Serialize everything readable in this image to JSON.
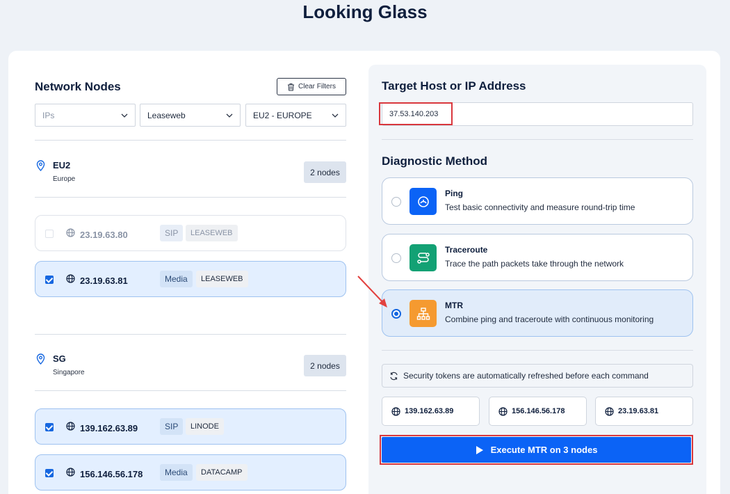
{
  "page": {
    "title": "Looking Glass"
  },
  "nodes_panel": {
    "title": "Network Nodes",
    "clear_filters_label": "Clear Filters",
    "filters": {
      "ips_placeholder": "IPs",
      "provider": "Leaseweb",
      "region": "EU2 - EUROPE"
    },
    "regions": [
      {
        "code": "EU2",
        "name": "Europe",
        "count_label": "2 nodes",
        "nodes": [
          {
            "ip": "23.19.63.80",
            "type": "SIP",
            "provider": "LEASEWEB",
            "checked": false,
            "disabled": true
          },
          {
            "ip": "23.19.63.81",
            "type": "Media",
            "provider": "LEASEWEB",
            "checked": true,
            "disabled": false
          }
        ]
      },
      {
        "code": "SG",
        "name": "Singapore",
        "count_label": "2 nodes",
        "nodes": [
          {
            "ip": "139.162.63.89",
            "type": "SIP",
            "provider": "LINODE",
            "checked": true,
            "disabled": false
          },
          {
            "ip": "156.146.56.178",
            "type": "Media",
            "provider": "DATACAMP",
            "checked": true,
            "disabled": false
          }
        ]
      }
    ]
  },
  "target": {
    "label": "Target Host or IP Address",
    "value": "37.53.140.203"
  },
  "method": {
    "label": "Diagnostic Method",
    "options": [
      {
        "title": "Ping",
        "description": "Test basic connectivity and measure round-trip time",
        "icon": "ping-icon",
        "color": "#0b63f6",
        "selected": false
      },
      {
        "title": "Traceroute",
        "description": "Trace the path packets take through the network",
        "icon": "route-icon",
        "color": "#13a174",
        "selected": false
      },
      {
        "title": "MTR",
        "description": "Combine ping and traceroute with continuous monitoring",
        "icon": "network-tree-icon",
        "color": "#f59a30",
        "selected": true
      }
    ]
  },
  "token_notice": "Security tokens are automatically refreshed before each command",
  "selected_nodes": [
    "139.162.63.89",
    "156.146.56.178",
    "23.19.63.81"
  ],
  "execute_label": "Execute MTR on 3 nodes",
  "colors": {
    "accent": "#0b63f6",
    "highlight": "#d9373d"
  }
}
